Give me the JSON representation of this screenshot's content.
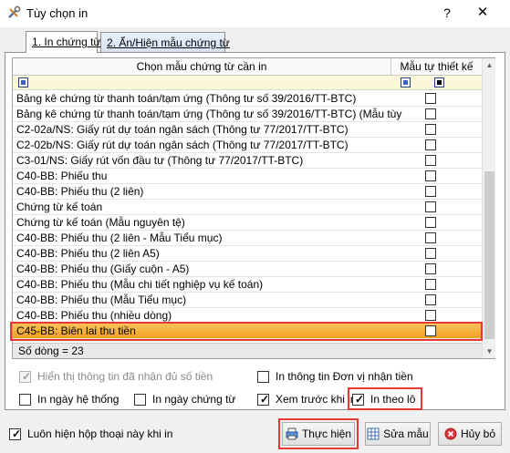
{
  "window": {
    "title": "Tùy chọn in",
    "help": "?",
    "close": "✕"
  },
  "tabs": [
    {
      "num": "1",
      "text": ". In chứng từ"
    },
    {
      "num": "2",
      "text": ". Ẩn/Hiện mẫu chứng từ"
    }
  ],
  "grid": {
    "col1": "Chọn mẫu chứng từ cần in",
    "col2": "Mẫu tự thiết kế",
    "rows": [
      "Bảng kê chứng từ thanh toán/tạm ứng (Thông tư số 39/2016/TT-BTC)",
      "Bảng kê chứng từ thanh toán/tạm ứng (Thông tư số 39/2016/TT-BTC) (Mẫu tùy",
      "C2-02a/NS: Giấy rút dự toán ngân sách (Thông tư 77/2017/TT-BTC)",
      "C2-02b/NS: Giấy rút dự toán ngân sách (Thông tư 77/2017/TT-BTC)",
      "C3-01/NS: Giấy rút vốn đầu tư (Thông tư 77/2017/TT-BTC)",
      "C40-BB: Phiếu thu",
      "C40-BB: Phiếu thu (2 liên)",
      "Chứng từ kế toán",
      "Chứng từ kế toán (Mẫu nguyên tệ)",
      "C40-BB: Phiếu thu (2 liên - Mẫu Tiểu mục)",
      "C40-BB: Phiếu thu (2 liên A5)",
      "C40-BB: Phiếu thu (Giấy cuộn - A5)",
      "C40-BB: Phiếu thu (Mẫu chi tiết nghiệp vụ kế toán)",
      "C40-BB: Phiếu thu (Mẫu Tiểu mục)",
      "C40-BB: Phiếu thu (nhiều dòng)",
      "C45-BB: Biên lai thu tiền"
    ],
    "selected_index": 15,
    "count": "Số dòng = 23"
  },
  "options": {
    "show_amount": "Hiển thị thông tin đã nhận đủ số tiền",
    "print_unit": "In thông tin Đơn vị nhận tiền",
    "print_sys_date": "In ngày hệ thống",
    "print_doc_date": "In ngày chứng từ",
    "preview": "Xem trước khi in",
    "print_batch": "In theo lô",
    "always_show": "Luôn hiện hộp thoại này khi in"
  },
  "buttons": {
    "execute": "Thực hiện",
    "edit": "Sửa mẫu",
    "cancel": "Hủy bỏ"
  }
}
